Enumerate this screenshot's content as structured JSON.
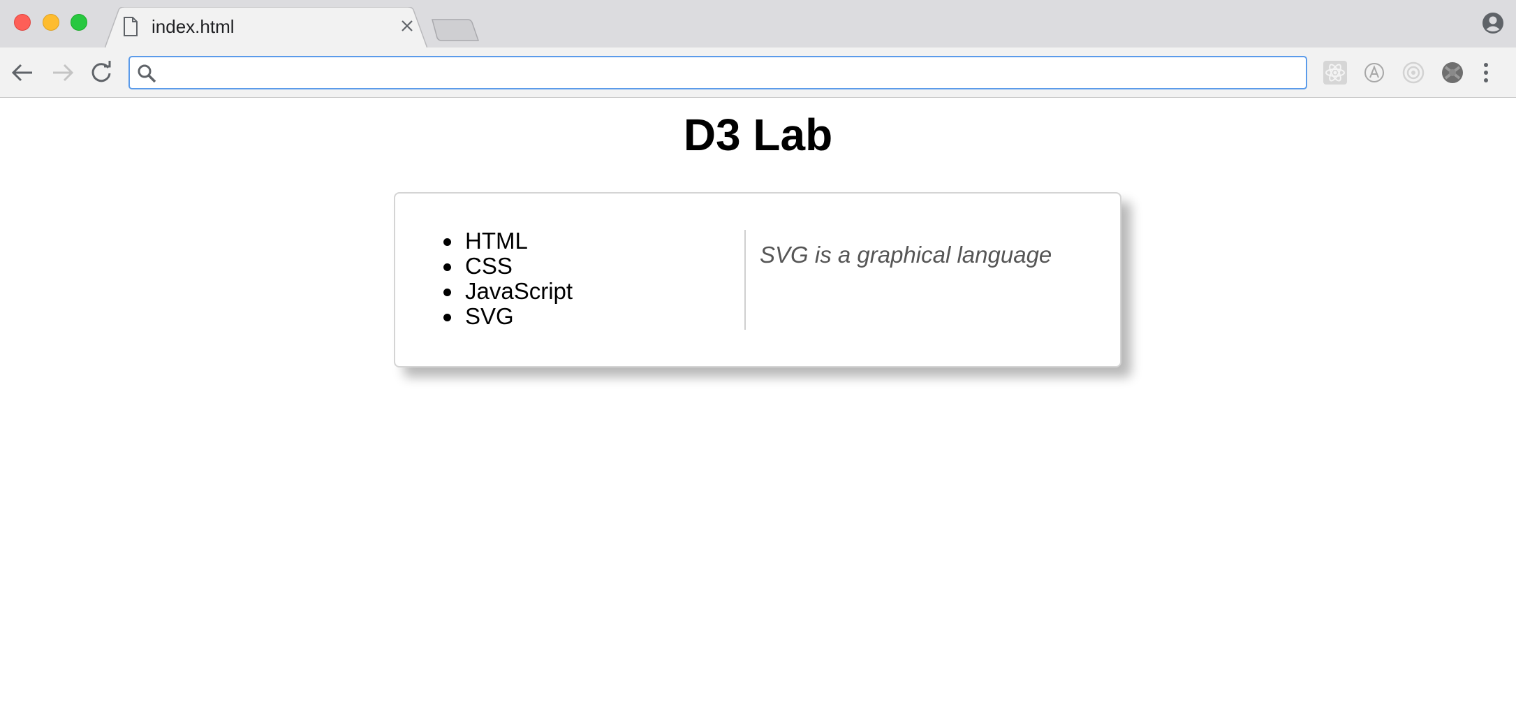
{
  "browser": {
    "tab": {
      "title": "index.html"
    },
    "omnibox": {
      "value": "",
      "placeholder": ""
    },
    "icons": {
      "file": "file-icon",
      "close": "close-icon",
      "new_tab": "new-tab-icon",
      "profile": "profile-icon",
      "back": "back-arrow-icon",
      "forward": "forward-arrow-icon",
      "reload": "reload-icon",
      "search": "search-icon",
      "extensions": [
        "react-devtools-icon",
        "a-circle-icon",
        "target-icon",
        "puzzle-icon"
      ],
      "menu": "kebab-menu-icon"
    },
    "colors": {
      "tabbar": "#dcdcdf",
      "toolbar": "#f2f2f2",
      "omnibox_focus": "#5b9bea"
    }
  },
  "page": {
    "title": "D3 Lab",
    "list_items": [
      "HTML",
      "CSS",
      "JavaScript",
      "SVG"
    ],
    "description": "SVG is a graphical language"
  }
}
